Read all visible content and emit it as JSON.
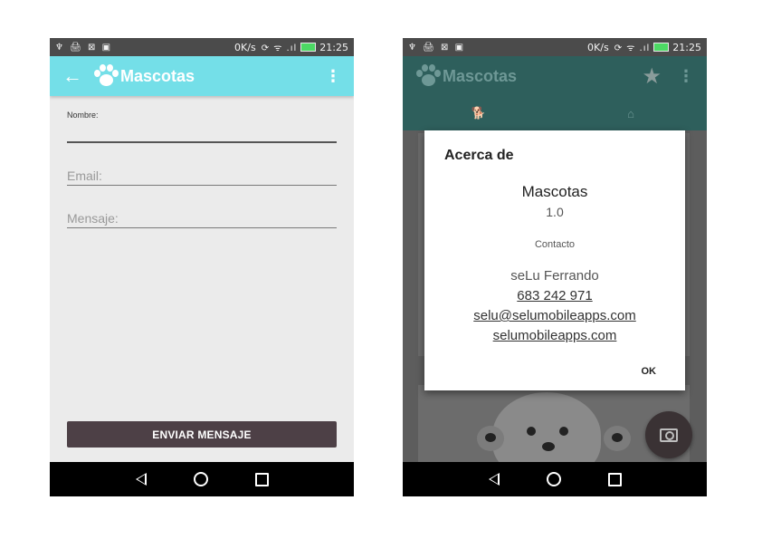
{
  "left_phone": {
    "status_bar": {
      "left_icons": "♆ 🖨 ⊠ ▣",
      "speed": "0K/s",
      "icons": "⟳ ᯤ .ıl",
      "time": "21:25"
    },
    "app_bar": {
      "back_glyph": "←",
      "title": "Mascotas",
      "overflow_glyph": "⋮",
      "color": "#74dfe8"
    },
    "form": {
      "name_label": "Nombre:",
      "email_label": "Email:",
      "message_label": "Mensaje:",
      "send_button": "ENVIAR MENSAJE"
    }
  },
  "right_phone": {
    "status_bar": {
      "left_icons": "♆ 🖨 ⊠ ▣",
      "speed": "0K/s",
      "icons": "⟳ ᯤ .ıl",
      "time": "21:25"
    },
    "app_bar": {
      "title": "Mascotas",
      "star_glyph": "★",
      "overflow_glyph": "⋮"
    },
    "tabs": [
      {
        "icon": "dog-icon",
        "glyph": "🐕"
      },
      {
        "icon": "home-icon",
        "glyph": "⌂"
      }
    ],
    "dialog": {
      "title": "Acerca de",
      "app_name": "Mascotas",
      "version": "1.0",
      "contact_label": "Contacto",
      "author": "seLu Ferrando",
      "phone": "683 242 971",
      "email": "selu@selumobileapps.com",
      "website": "selumobileapps.com",
      "ok": "OK"
    }
  },
  "colors": {
    "accent_left": "#74dfe8",
    "accent_right": "#2e5f5c",
    "button": "#4d4046"
  }
}
